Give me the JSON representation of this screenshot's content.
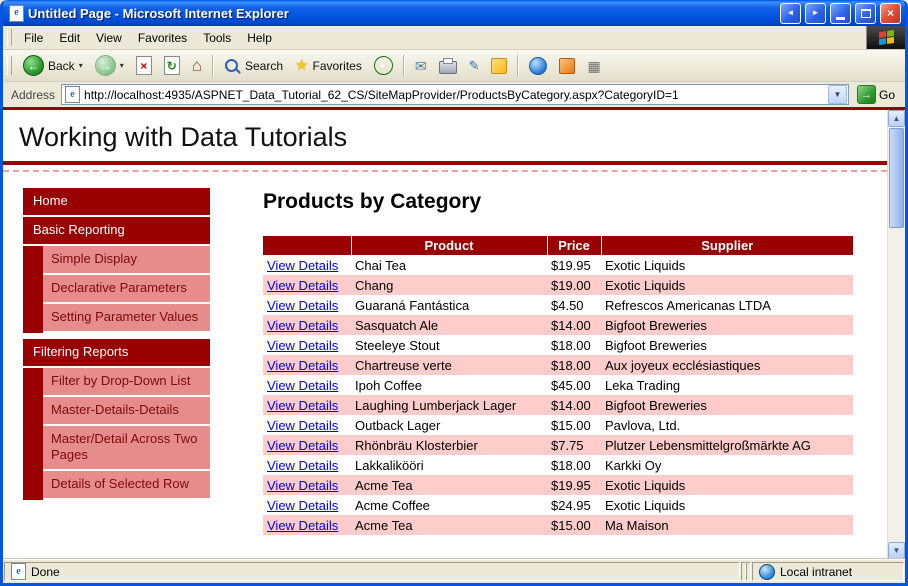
{
  "window": {
    "title": "Untitled Page - Microsoft Internet Explorer",
    "status": {
      "left": "Done",
      "right": "Local intranet"
    }
  },
  "menu": {
    "items": [
      "File",
      "Edit",
      "View",
      "Favorites",
      "Tools",
      "Help"
    ]
  },
  "toolbar": {
    "back": "Back",
    "search": "Search",
    "favorites": "Favorites"
  },
  "address": {
    "label": "Address",
    "url": "http://localhost:4935/ASPNET_Data_Tutorial_62_CS/SiteMapProvider/ProductsByCategory.aspx?CategoryID=1",
    "go": "Go"
  },
  "site": {
    "title": "Working with Data Tutorials",
    "heading": "Products by Category",
    "sidebar": [
      {
        "label": "Home",
        "level": 0
      },
      {
        "label": "Basic Reporting",
        "level": 0
      },
      {
        "label": "Simple Display",
        "level": 1
      },
      {
        "label": "Declarative Parameters",
        "level": 1
      },
      {
        "label": "Setting Parameter Values",
        "level": 1
      },
      {
        "label": "Filtering Reports",
        "level": 0
      },
      {
        "label": "Filter by Drop-Down List",
        "level": 1
      },
      {
        "label": "Master-Details-Details",
        "level": 1
      },
      {
        "label": "Master/Detail Across Two Pages",
        "level": 1
      },
      {
        "label": "Details of Selected Row",
        "level": 1
      }
    ],
    "table": {
      "headers": [
        "",
        "Product",
        "Price",
        "Supplier"
      ],
      "link_text": "View Details",
      "rows": [
        {
          "product": "Chai Tea",
          "price": "$19.95",
          "supplier": "Exotic Liquids"
        },
        {
          "product": "Chang",
          "price": "$19.00",
          "supplier": "Exotic Liquids"
        },
        {
          "product": "Guaraná Fantástica",
          "price": "$4.50",
          "supplier": "Refrescos Americanas LTDA"
        },
        {
          "product": "Sasquatch Ale",
          "price": "$14.00",
          "supplier": "Bigfoot Breweries"
        },
        {
          "product": "Steeleye Stout",
          "price": "$18.00",
          "supplier": "Bigfoot Breweries"
        },
        {
          "product": "Chartreuse verte",
          "price": "$18.00",
          "supplier": "Aux joyeux ecclésiastiques"
        },
        {
          "product": "Ipoh Coffee",
          "price": "$45.00",
          "supplier": "Leka Trading"
        },
        {
          "product": "Laughing Lumberjack Lager",
          "price": "$14.00",
          "supplier": "Bigfoot Breweries"
        },
        {
          "product": "Outback Lager",
          "price": "$15.00",
          "supplier": "Pavlova, Ltd."
        },
        {
          "product": "Rhönbräu Klosterbier",
          "price": "$7.75",
          "supplier": "Plutzer Lebensmittelgroßmärkte AG"
        },
        {
          "product": "Lakkalikööri",
          "price": "$18.00",
          "supplier": "Karkki Oy"
        },
        {
          "product": "Acme Tea",
          "price": "$19.95",
          "supplier": "Exotic Liquids"
        },
        {
          "product": "Acme Coffee",
          "price": "$24.95",
          "supplier": "Exotic Liquids"
        },
        {
          "product": "Acme Tea",
          "price": "$15.00",
          "supplier": "Ma Maison"
        }
      ]
    }
  },
  "colors": {
    "maroon": "#990000",
    "sidebar_pink": "#E78C8C",
    "row_pink": "#FFCCCC",
    "link_blue": "#0000EE",
    "titlebar_blue": "#0154E0"
  }
}
